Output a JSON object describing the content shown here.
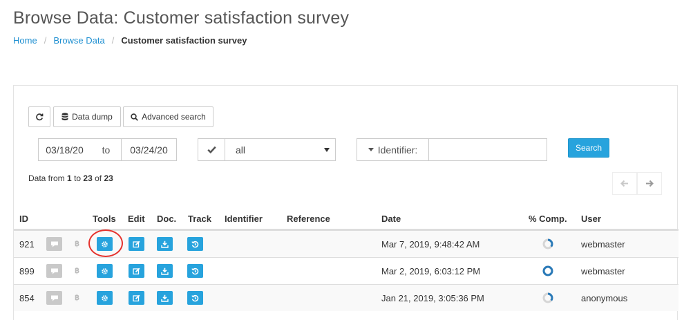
{
  "page": {
    "title": "Browse Data: Customer satisfaction survey"
  },
  "breadcrumb": {
    "items": [
      {
        "label": "Home"
      },
      {
        "label": "Browse Data"
      },
      {
        "label": "Customer satisfaction survey"
      }
    ],
    "separator": "/"
  },
  "toolbar": {
    "refresh_icon": "refresh-icon",
    "data_dump_label": "Data dump",
    "advanced_search_label": "Advanced search"
  },
  "filters": {
    "date_from": "03/18/20",
    "date_to_label": "to",
    "date_to": "03/24/20",
    "status_selected": "all",
    "identifier_label": "Identifier:",
    "identifier_value": "",
    "search_label": "Search"
  },
  "results_info": {
    "prefix": "Data from",
    "from": "1",
    "to_word": "to",
    "to": "23",
    "of_word": "of",
    "total": "23"
  },
  "table": {
    "headers": {
      "id": "ID",
      "tools": "Tools",
      "edit": "Edit",
      "doc": "Doc.",
      "track": "Track",
      "identifier": "Identifier",
      "reference": "Reference",
      "date": "Date",
      "completion": "% Comp.",
      "user": "User"
    },
    "rows": [
      {
        "id": "921",
        "identifier": "",
        "reference": "",
        "date": "Mar 7, 2019, 9:48:42 AM",
        "completion_pct": 35,
        "user": "webmaster"
      },
      {
        "id": "899",
        "identifier": "",
        "reference": "",
        "date": "Mar 2, 2019, 6:03:12 PM",
        "completion_pct": 100,
        "user": "webmaster"
      },
      {
        "id": "854",
        "identifier": "",
        "reference": "",
        "date": "Jan 21, 2019, 3:05:36 PM",
        "completion_pct": 35,
        "user": "anonymous"
      }
    ]
  },
  "colors": {
    "accent": "#27a3dd",
    "link": "#1e8fd1",
    "annotation": "#e5322d"
  }
}
